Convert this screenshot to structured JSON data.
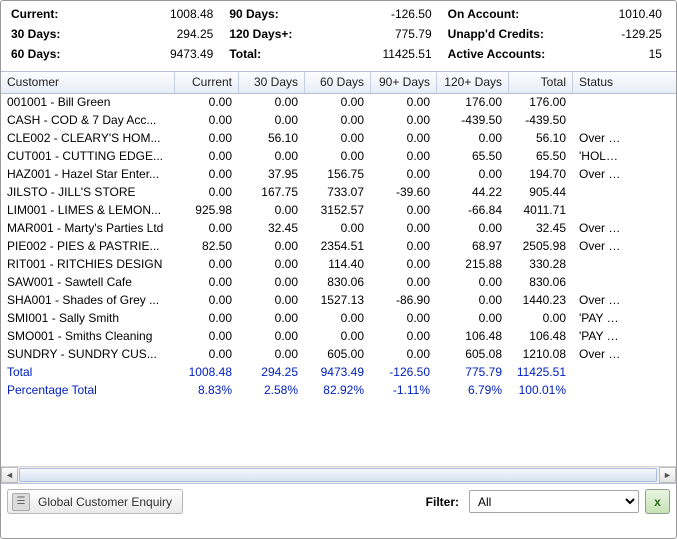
{
  "summary": {
    "col1": [
      {
        "label": "Current:",
        "value": "1008.48"
      },
      {
        "label": "30 Days:",
        "value": "294.25"
      },
      {
        "label": "60 Days:",
        "value": "9473.49"
      }
    ],
    "col2": [
      {
        "label": "90 Days:",
        "value": "-126.50"
      },
      {
        "label": "120 Days+:",
        "value": "775.79"
      },
      {
        "label": "Total:",
        "value": "11425.51"
      }
    ],
    "col3": [
      {
        "label": "On Account:",
        "value": "1010.40"
      },
      {
        "label": "Unapp'd Credits:",
        "value": "-129.25"
      },
      {
        "label": "Active Accounts:",
        "value": "15"
      }
    ]
  },
  "headers": {
    "customer": "Customer",
    "current": "Current",
    "d30": "30 Days",
    "d60": "60 Days",
    "d90": "90+ Days",
    "d120": "120+ Days",
    "total": "Total",
    "status": "Status"
  },
  "rows": [
    {
      "customer": "001001 - Bill Green",
      "current": "0.00",
      "d30": "0.00",
      "d60": "0.00",
      "d90": "0.00",
      "d120": "176.00",
      "total": "176.00",
      "status": ""
    },
    {
      "customer": "CASH  - COD & 7 Day Acc...",
      "current": "0.00",
      "d30": "0.00",
      "d60": "0.00",
      "d90": "0.00",
      "d120": "-439.50",
      "total": "-439.50",
      "status": ""
    },
    {
      "customer": "CLE002 - CLEARY'S HOM...",
      "current": "0.00",
      "d30": "56.10",
      "d60": "0.00",
      "d90": "0.00",
      "d120": "0.00",
      "total": "56.10",
      "status": "Over C/L"
    },
    {
      "customer": "CUT001 - CUTTING EDGE...",
      "current": "0.00",
      "d30": "0.00",
      "d60": "0.00",
      "d90": "0.00",
      "d120": "65.50",
      "total": "65.50",
      "status": "'HOLD' Ove"
    },
    {
      "customer": "HAZ001 - Hazel Star Enter...",
      "current": "0.00",
      "d30": "37.95",
      "d60": "156.75",
      "d90": "0.00",
      "d120": "0.00",
      "total": "194.70",
      "status": "Over C/L"
    },
    {
      "customer": "JILSTO - JILL'S STORE",
      "current": "0.00",
      "d30": "167.75",
      "d60": "733.07",
      "d90": "-39.60",
      "d120": "44.22",
      "total": "905.44",
      "status": ""
    },
    {
      "customer": "LIM001 - LIMES & LEMON...",
      "current": "925.98",
      "d30": "0.00",
      "d60": "3152.57",
      "d90": "0.00",
      "d120": "-66.84",
      "total": "4011.71",
      "status": ""
    },
    {
      "customer": "MAR001 - Marty's Parties Ltd",
      "current": "0.00",
      "d30": "32.45",
      "d60": "0.00",
      "d90": "0.00",
      "d120": "0.00",
      "total": "32.45",
      "status": "Over C/L"
    },
    {
      "customer": "PIE002 - PIES & PASTRIE...",
      "current": "82.50",
      "d30": "0.00",
      "d60": "2354.51",
      "d90": "0.00",
      "d120": "68.97",
      "total": "2505.98",
      "status": "Over C/L"
    },
    {
      "customer": "RIT001 - RITCHIES DESIGN",
      "current": "0.00",
      "d30": "0.00",
      "d60": "114.40",
      "d90": "0.00",
      "d120": "215.88",
      "total": "330.28",
      "status": ""
    },
    {
      "customer": "SAW001 - Sawtell Cafe",
      "current": "0.00",
      "d30": "0.00",
      "d60": "830.06",
      "d90": "0.00",
      "d120": "0.00",
      "total": "830.06",
      "status": ""
    },
    {
      "customer": "SHA001 - Shades of Grey ...",
      "current": "0.00",
      "d30": "0.00",
      "d60": "1527.13",
      "d90": "-86.90",
      "d120": "0.00",
      "total": "1440.23",
      "status": "Over C/L"
    },
    {
      "customer": "SMI001 - Sally Smith",
      "current": "0.00",
      "d30": "0.00",
      "d60": "0.00",
      "d90": "0.00",
      "d120": "0.00",
      "total": "0.00",
      "status": "'PAY ON PIC"
    },
    {
      "customer": "SMO001 - Smiths Cleaning",
      "current": "0.00",
      "d30": "0.00",
      "d60": "0.00",
      "d90": "0.00",
      "d120": "106.48",
      "total": "106.48",
      "status": "'PAY ON PIC"
    },
    {
      "customer": "SUNDRY - SUNDRY CUS...",
      "current": "0.00",
      "d30": "0.00",
      "d60": "605.00",
      "d90": "0.00",
      "d120": "605.08",
      "total": "1210.08",
      "status": "Over C/L"
    }
  ],
  "totals": {
    "label": "Total",
    "current": "1008.48",
    "d30": "294.25",
    "d60": "9473.49",
    "d90": "-126.50",
    "d120": "775.79",
    "total": "11425.51"
  },
  "pct": {
    "label": "Percentage Total",
    "current": "8.83%",
    "d30": "2.58%",
    "d60": "82.92%",
    "d90": "-1.11%",
    "d120": "6.79%",
    "total": "100.01%"
  },
  "footer": {
    "enquiry": "Global Customer Enquiry",
    "filterLabel": "Filter:",
    "filterValue": "All"
  }
}
